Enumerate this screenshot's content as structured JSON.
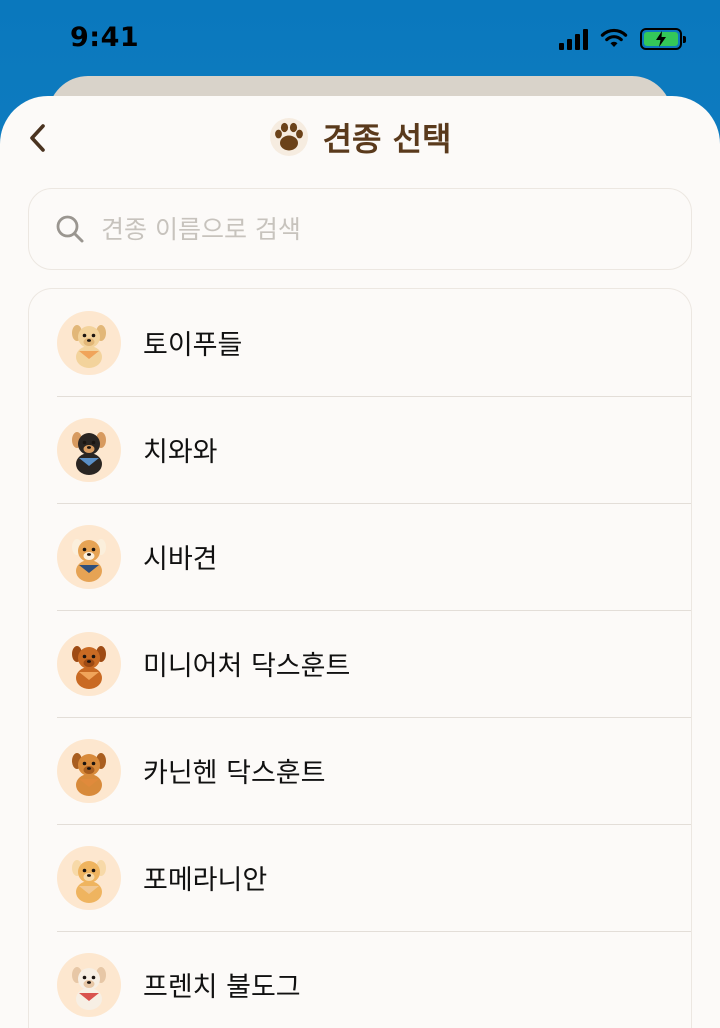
{
  "status_bar": {
    "time": "9:41"
  },
  "header": {
    "title": "견종 선택"
  },
  "search": {
    "placeholder": "견종 이름으로 검색"
  },
  "breeds": [
    {
      "label": "토이푸들",
      "icon": "toy-poodle-icon",
      "fur": "#f3d39c",
      "dark": "#e2b778",
      "scarf": "#f0a45a"
    },
    {
      "label": "치와와",
      "icon": "chihuahua-icon",
      "fur": "#2a2522",
      "dark": "#d79a5f",
      "scarf": "#5a8fc7"
    },
    {
      "label": "시바견",
      "icon": "shiba-icon",
      "fur": "#e6a354",
      "dark": "#fbefdc",
      "scarf": "#2f4f7c"
    },
    {
      "label": "미니어처 닥스훈트",
      "icon": "miniature-dachshund-icon",
      "fur": "#c96a23",
      "dark": "#9e4b14",
      "scarf": "#f0a45a"
    },
    {
      "label": "카닌헨 닥스훈트",
      "icon": "kaninchen-dachshund-icon",
      "fur": "#d88a3a",
      "dark": "#a95e1f",
      "scarf": "#e08a3c"
    },
    {
      "label": "포메라니안",
      "icon": "pomeranian-icon",
      "fur": "#efb45f",
      "dark": "#f7d9a8",
      "scarf": "#f2c893"
    },
    {
      "label": "프렌치 불도그",
      "icon": "french-bulldog-icon",
      "fur": "#f7efe4",
      "dark": "#e7c7a6",
      "scarf": "#d9534f"
    }
  ],
  "colors": {
    "accent": "#5a3a1c",
    "sky": "#0a78bd",
    "battery": "#34c759"
  }
}
